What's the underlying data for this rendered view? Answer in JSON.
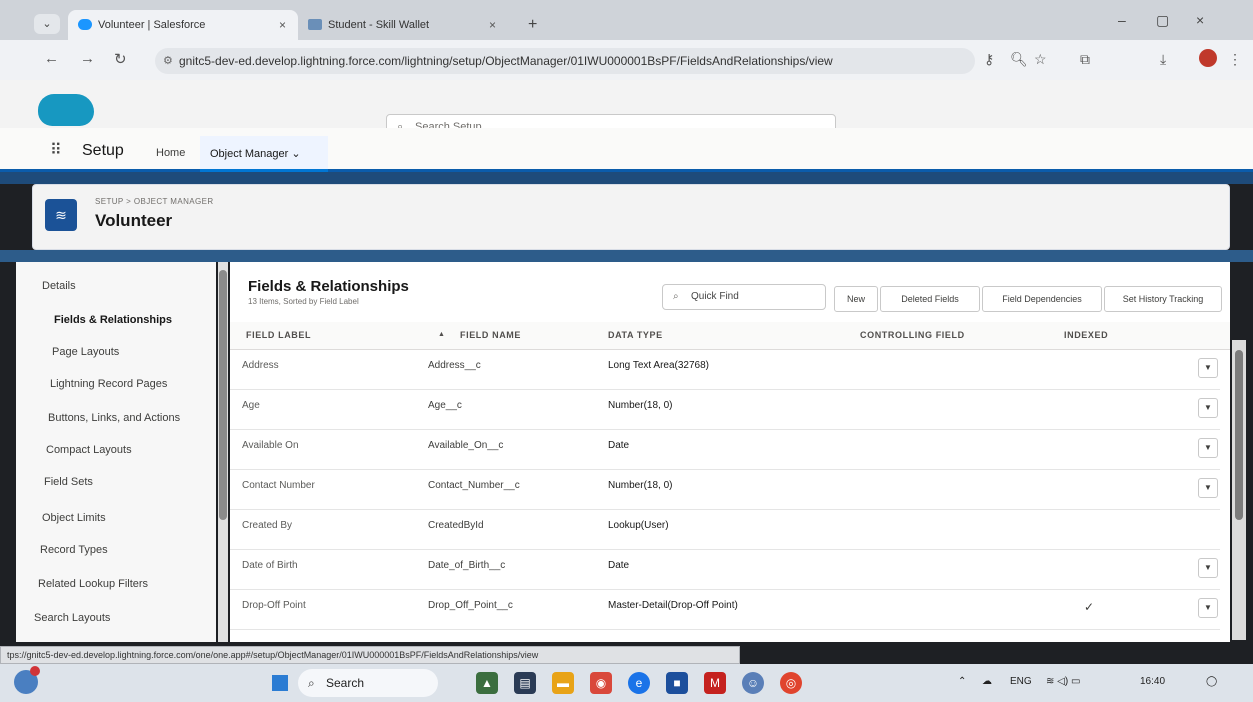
{
  "browser": {
    "tabs": [
      {
        "title": "Volunteer | Salesforce",
        "close": "×"
      },
      {
        "title": "Student - Skill Wallet",
        "close": "×"
      }
    ],
    "new_tab": "+",
    "url": "gnitc5-dev-ed.develop.lightning.force.com/lightning/setup/ObjectManager/01IWU000001BsPF/FieldsAndRelationships/view",
    "status_url": "tps://gnitc5-dev-ed.develop.lightning.force.com/one/one.app#/setup/ObjectManager/01IWU000001BsPF/FieldsAndRelationships/view"
  },
  "sf": {
    "search_placeholder": "Search Setup",
    "app_title": "Setup",
    "nav_home": "Home",
    "nav_object_manager": "Object Manager",
    "breadcrumb": "SETUP > OBJECT MANAGER",
    "object_title": "Volunteer"
  },
  "sidebar": {
    "items": [
      {
        "label": "Details"
      },
      {
        "label": "Fields & Relationships"
      },
      {
        "label": "Page Layouts"
      },
      {
        "label": "Lightning Record Pages"
      },
      {
        "label": "Buttons, Links, and Actions"
      },
      {
        "label": "Compact Layouts"
      },
      {
        "label": "Field Sets"
      },
      {
        "label": "Object Limits"
      },
      {
        "label": "Record Types"
      },
      {
        "label": "Related Lookup Filters"
      },
      {
        "label": "Search Layouts"
      }
    ]
  },
  "main": {
    "title": "Fields & Relationships",
    "subtitle": "13 Items, Sorted by Field Label",
    "quick_find": "Quick Find",
    "buttons": {
      "new": "New",
      "deleted": "Deleted Fields",
      "dependencies": "Field Dependencies",
      "history": "Set History Tracking"
    },
    "columns": {
      "label": "FIELD LABEL",
      "name": "FIELD NAME",
      "type": "DATA TYPE",
      "controlling": "CONTROLLING FIELD",
      "indexed": "INDEXED"
    },
    "rows": [
      {
        "label": "Address",
        "name": "Address__c",
        "type": "Long Text Area(32768)",
        "indexed": ""
      },
      {
        "label": "Age",
        "name": "Age__c",
        "type": "Number(18, 0)",
        "indexed": ""
      },
      {
        "label": "Available On",
        "name": "Available_On__c",
        "type": "Date",
        "indexed": ""
      },
      {
        "label": "Contact Number",
        "name": "Contact_Number__c",
        "type": "Number(18, 0)",
        "indexed": ""
      },
      {
        "label": "Created By",
        "name": "CreatedById",
        "type": "Lookup(User)",
        "indexed": ""
      },
      {
        "label": "Date of Birth",
        "name": "Date_of_Birth__c",
        "type": "Date",
        "indexed": ""
      },
      {
        "label": "Drop-Off Point",
        "name": "Drop_Off_Point__c",
        "type": "Master-Detail(Drop-Off Point)",
        "indexed": "✓"
      }
    ]
  },
  "taskbar": {
    "search": "Search",
    "lang": "ENG",
    "time": "16:40"
  }
}
